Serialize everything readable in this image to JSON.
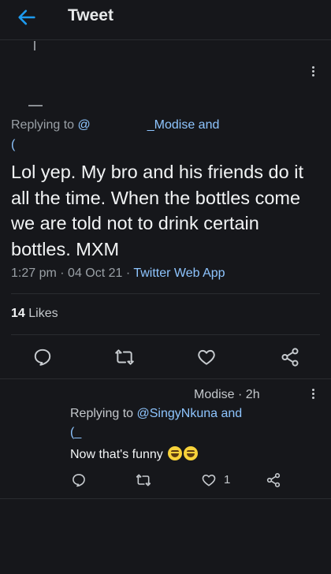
{
  "header": {
    "title": "Tweet"
  },
  "tweet": {
    "replying_label": "Replying to",
    "replying_handle": "@",
    "replying_rest": "_Modise and",
    "replying_line2": "(",
    "text": "Lol yep. My bro and his friends do it all the time. When the bottles come we are told not to drink certain bottles. MXM",
    "time": "1:27 pm",
    "date": "04 Oct 21",
    "source": "Twitter Web App",
    "likes_count": "14",
    "likes_label": "Likes"
  },
  "reply": {
    "author": "Modise · 2h",
    "replying_label": "Replying to",
    "replying_handle": "@SingyNkuna and",
    "replying_line2": "(_",
    "text": "Now that's funny",
    "like_count": "1"
  },
  "icons": {
    "back": "arrow-left-icon",
    "more": "more-vertical-icon",
    "reply": "comment-icon",
    "retweet": "retweet-icon",
    "like": "heart-icon",
    "share": "share-icon"
  },
  "colors": {
    "background": "#16171b",
    "accent": "#1d9bf0",
    "link": "#8ec5ff",
    "text": "#f2f4f5",
    "muted": "#9aa0a6"
  }
}
